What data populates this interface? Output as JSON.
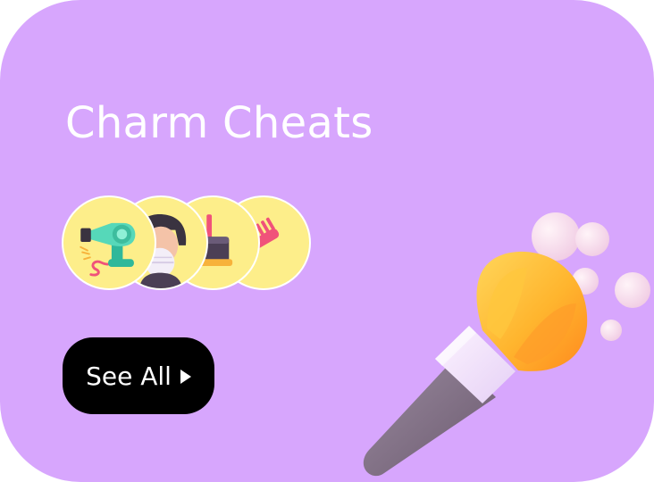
{
  "card": {
    "title": "Charm Cheats",
    "background_color": "#d7a6fd"
  },
  "icons": [
    {
      "name": "hair-dryer-icon"
    },
    {
      "name": "face-mask-icon"
    },
    {
      "name": "makeup-kit-icon"
    },
    {
      "name": "comb-icon"
    }
  ],
  "button": {
    "label": "See All",
    "icon": "play-triangle-icon"
  },
  "illustration": {
    "name": "makeup-brush-icon"
  },
  "colors": {
    "accent": "#d7a6fd",
    "icon_bg": "#fdee8a",
    "button_bg": "#000000",
    "text": "#ffffff"
  }
}
